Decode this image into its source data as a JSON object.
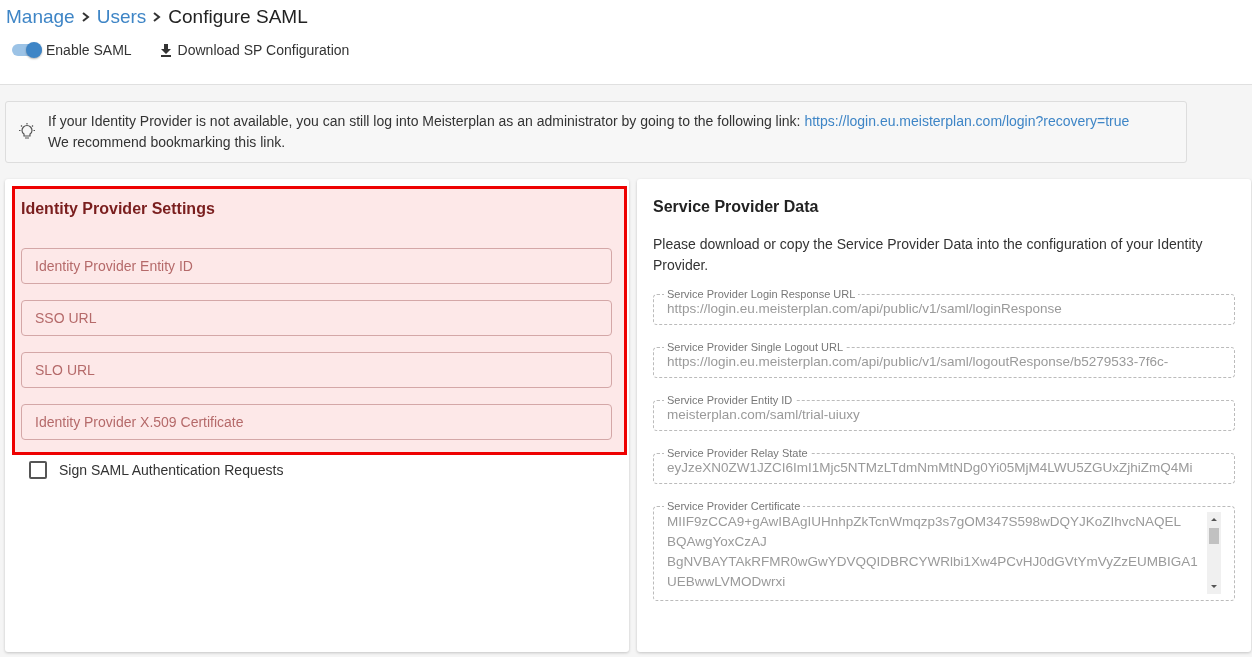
{
  "breadcrumb": [
    {
      "label": "Manage",
      "link": true
    },
    {
      "label": "Users",
      "link": true
    },
    {
      "label": "Configure SAML",
      "link": false
    }
  ],
  "toolbar": {
    "toggle": {
      "label": "Enable SAML",
      "on": true
    },
    "download": {
      "label": "Download SP Configuration"
    }
  },
  "notice": {
    "text": "If your Identity Provider is not available, you can still log into Meisterplan as an administrator by going to the following link:",
    "link": "https://login.eu.meisterplan.com/login?recovery=true",
    "note": "We recommend bookmarking this link."
  },
  "identity_provider": {
    "title": "Identity Provider Settings",
    "highlighted": true,
    "fields": [
      {
        "placeholder": "Identity Provider Entity ID"
      },
      {
        "placeholder": "SSO URL"
      },
      {
        "placeholder": "SLO URL"
      },
      {
        "placeholder": "Identity Provider X.509 Certificate"
      }
    ],
    "checkbox": {
      "label": "Sign SAML Authentication Requests",
      "checked": false
    }
  },
  "service_provider": {
    "title": "Service Provider Data",
    "description": "Please download or copy the Service Provider Data into the configuration of your Identity Provider.",
    "fields": [
      {
        "kind": "single",
        "label": "Service Provider Login Response URL",
        "value": "https://login.eu.meisterplan.com/api/public/v1/saml/loginResponse"
      },
      {
        "kind": "single",
        "label": "Service Provider Single Logout URL",
        "value": "https://login.eu.meisterplan.com/api/public/v1/saml/logoutResponse/b5279533-7f6c-"
      },
      {
        "kind": "single",
        "label": "Service Provider Entity ID",
        "value": "meisterplan.com/saml/trial-uiuxy"
      },
      {
        "kind": "single",
        "label": "Service Provider Relay State",
        "value": "eyJzeXN0ZW1JZCI6ImI1Mjc5NTMzLTdmNmMtNDg0Yi05MjM4LWU5ZGUxZjhiZmQ4Mi"
      },
      {
        "kind": "multi",
        "label": "Service Provider Certificate",
        "lines": [
          "MIIF9zCCA9+gAwIBAgIUHnhpZkTcnWmqzp3s7gOM347S598wDQYJKoZIhvcNAQEL",
          "BQAwgYoxCzAJ",
          "BgNVBAYTAkRFMR0wGwYDVQQIDBRCYWRlbi1Xw4PCvHJ0dGVtYmVyZzEUMBIGA1",
          "UEBwwLVMODwrxi"
        ]
      }
    ]
  }
}
